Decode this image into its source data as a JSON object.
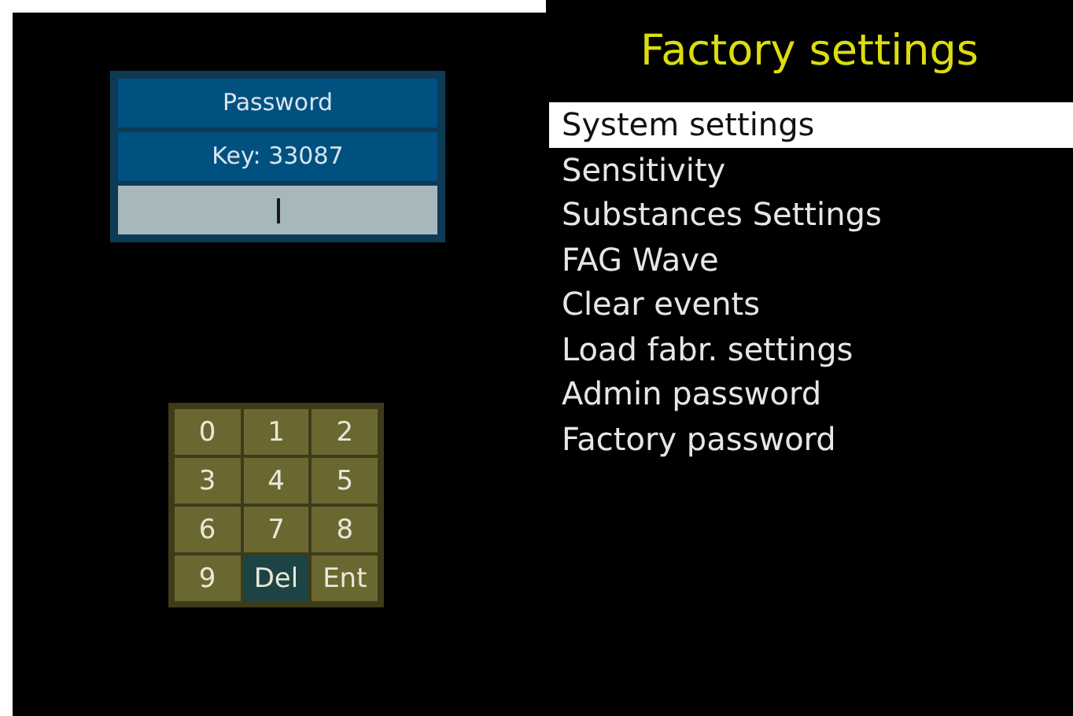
{
  "password_dialog": {
    "title": "Password",
    "key_label": "Key: 33087",
    "input": {
      "focused": true
    }
  },
  "keypad": [
    {
      "label": "0",
      "selected": false
    },
    {
      "label": "1",
      "selected": false
    },
    {
      "label": "2",
      "selected": false
    },
    {
      "label": "3",
      "selected": false
    },
    {
      "label": "4",
      "selected": false
    },
    {
      "label": "5",
      "selected": false
    },
    {
      "label": "6",
      "selected": false
    },
    {
      "label": "7",
      "selected": false
    },
    {
      "label": "8",
      "selected": false
    },
    {
      "label": "9",
      "selected": false
    },
    {
      "label": "Del",
      "selected": true
    },
    {
      "label": "Ent",
      "selected": false
    }
  ],
  "menu": {
    "title": "Factory settings",
    "items": [
      {
        "label": "System settings",
        "selected": true
      },
      {
        "label": "Sensitivity",
        "selected": false
      },
      {
        "label": "Substances Settings",
        "selected": false
      },
      {
        "label": "FAG Wave",
        "selected": false
      },
      {
        "label": "Clear events",
        "selected": false
      },
      {
        "label": "Load fabr. settings",
        "selected": false
      },
      {
        "label": "Admin password",
        "selected": false
      },
      {
        "label": "Factory password",
        "selected": false
      }
    ]
  }
}
